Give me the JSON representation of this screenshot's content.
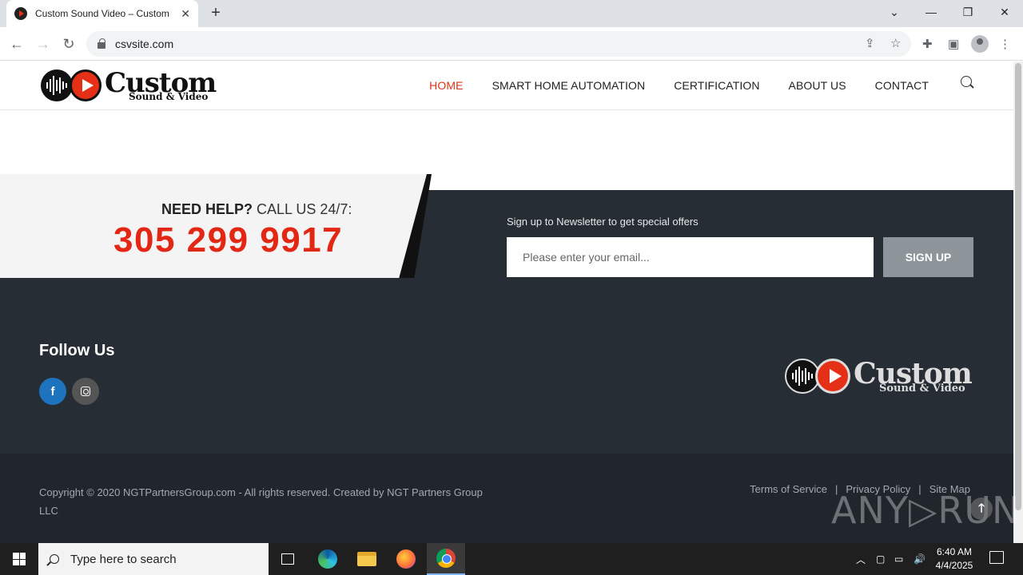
{
  "browser": {
    "tab_title": "Custom Sound Video – Custom",
    "tab_close": "✕",
    "new_tab": "+",
    "url": "csvsite.com",
    "window_controls": [
      "⌄",
      "—",
      "❐",
      "✕"
    ]
  },
  "site": {
    "logo": {
      "big": "Custom",
      "small": "Sound & Video"
    },
    "nav": [
      "HOME",
      "SMART HOME AUTOMATION",
      "CERTIFICATION",
      "ABOUT US",
      "CONTACT"
    ],
    "active_nav": "HOME",
    "colors": {
      "accent": "#e22714",
      "footer": "#262d34",
      "footer_bottom": "#20262c"
    }
  },
  "help": {
    "bold": "NEED HELP?",
    "rest": " CALL US 24/7:",
    "phone": "305 299 9917"
  },
  "newsletter": {
    "label": "Sign up to Newsletter to get special offers",
    "placeholder": "Please enter your email...",
    "button": "SIGN UP"
  },
  "follow": {
    "title": "Follow Us",
    "icons": [
      "facebook-icon",
      "instagram-icon"
    ],
    "fb_glyph": "f"
  },
  "footer": {
    "copyright": "Copyright © 2020  NGTPartnersGroup.com   - All rights reserved. Created by NGT Partners Group LLC",
    "links": [
      "Terms of Service",
      "Privacy Policy",
      "Site Map"
    ],
    "separator": "|",
    "to_top": "🡑"
  },
  "watermark": "ANY▷RUN",
  "taskbar": {
    "search_placeholder": "Type here to search",
    "time": "6:40 AM",
    "date": "4/4/2025"
  }
}
